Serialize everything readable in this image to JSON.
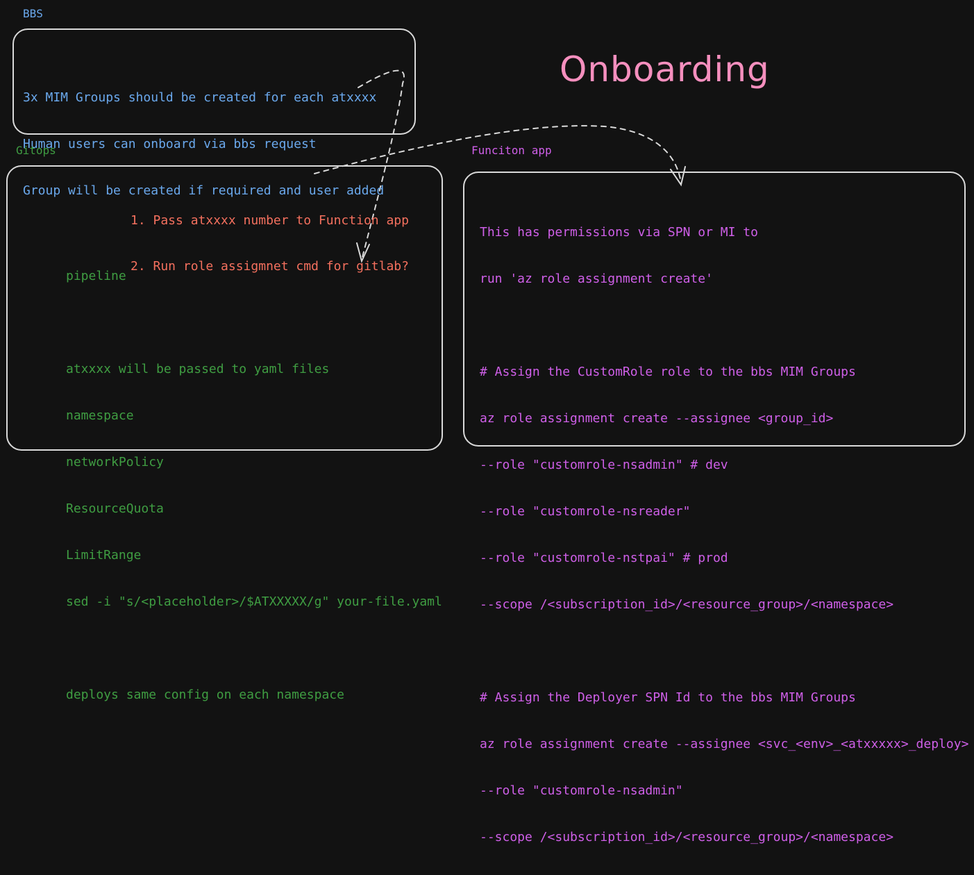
{
  "title": "Onboarding",
  "bbs": {
    "heading": "BBS",
    "lines": [
      "3x MIM Groups should be created for each atxxxx",
      "Human users can onboard via bbs request",
      "Group will be created if required and user added"
    ]
  },
  "gitops": {
    "heading": "Gitops",
    "steps": [
      "1. Pass atxxxx number to Function app",
      "2. Run role assigmnet cmd for gitlab?"
    ],
    "lines": [
      "pipeline",
      "",
      "atxxxx will be passed to yaml files",
      "namespace",
      "networkPolicy",
      "ResourceQuota",
      "LimitRange",
      "sed -i \"s/<placeholder>/$ATXXXXX/g\" your-file.yaml",
      "",
      "deploys same config on each namespace"
    ]
  },
  "function_app": {
    "heading": "Funciton app",
    "lines": [
      "This has permissions via SPN or MI to",
      "run 'az role assignment create'",
      "",
      "# Assign the CustomRole role to the bbs MIM Groups",
      "az role assignment create --assignee <group_id>",
      "--role \"customrole-nsadmin\" # dev",
      "--role \"customrole-nsreader\"",
      "--role \"customrole-nstpai\" # prod",
      "--scope /<subscription_id>/<resource_group>/<namespace>",
      "",
      "# Assign the Deployer SPN Id to the bbs MIM Groups",
      "az role assignment create --assignee <svc_<env>_<atxxxxx>_deploy>",
      "--role \"customrole-nsadmin\"",
      "--scope /<subscription_id>/<resource_group>/<namespace>"
    ]
  },
  "colors": {
    "bbs_text": "#6aa8ec",
    "gitops_text": "#3f9d42",
    "steps_text": "#f4705e",
    "function_app_text": "#cf5fe8",
    "title_text": "#f58fbe",
    "box_stroke": "#d9d9d9",
    "background": "#121212"
  }
}
